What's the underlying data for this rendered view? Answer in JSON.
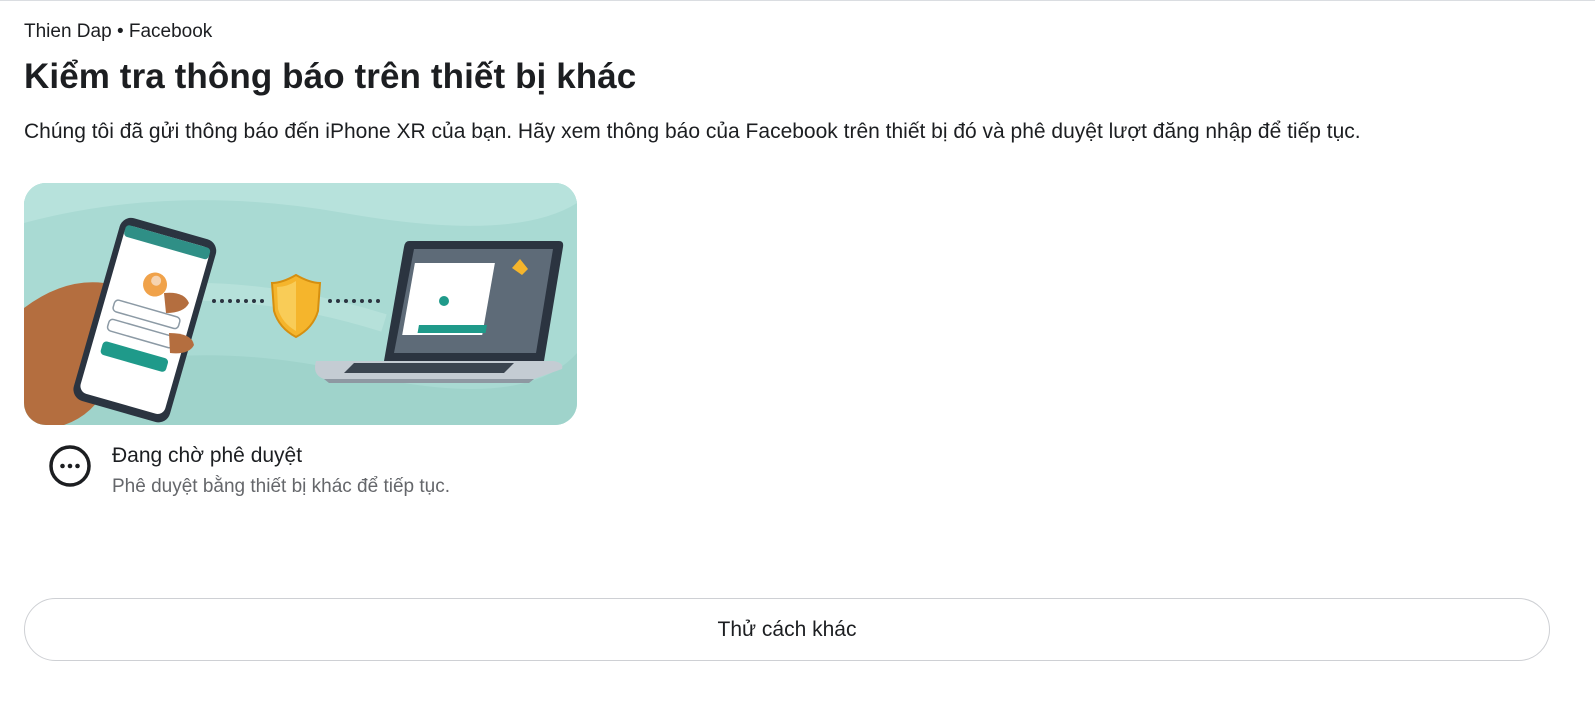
{
  "header": {
    "account_label": "Thien Dap • Facebook"
  },
  "main": {
    "title": "Kiểm tra thông báo trên thiết bị khác",
    "description": "Chúng tôi đã gửi thông báo đến iPhone XR của bạn. Hãy xem thông báo của Facebook trên thiết bị đó và phê duyệt lượt đăng nhập để tiếp tục."
  },
  "status": {
    "icon": "more-dots-icon",
    "title": "Đang chờ phê duyệt",
    "subtitle": "Phê duyệt bằng thiết bị khác để tiếp tục."
  },
  "actions": {
    "try_another_label": "Thử cách khác"
  },
  "colors": {
    "illustration_bg": "#a8d9d2",
    "teal": "#1f9a8a",
    "shield": "#f5b52c",
    "muted_text": "#65676b",
    "border": "#ced0d4"
  }
}
